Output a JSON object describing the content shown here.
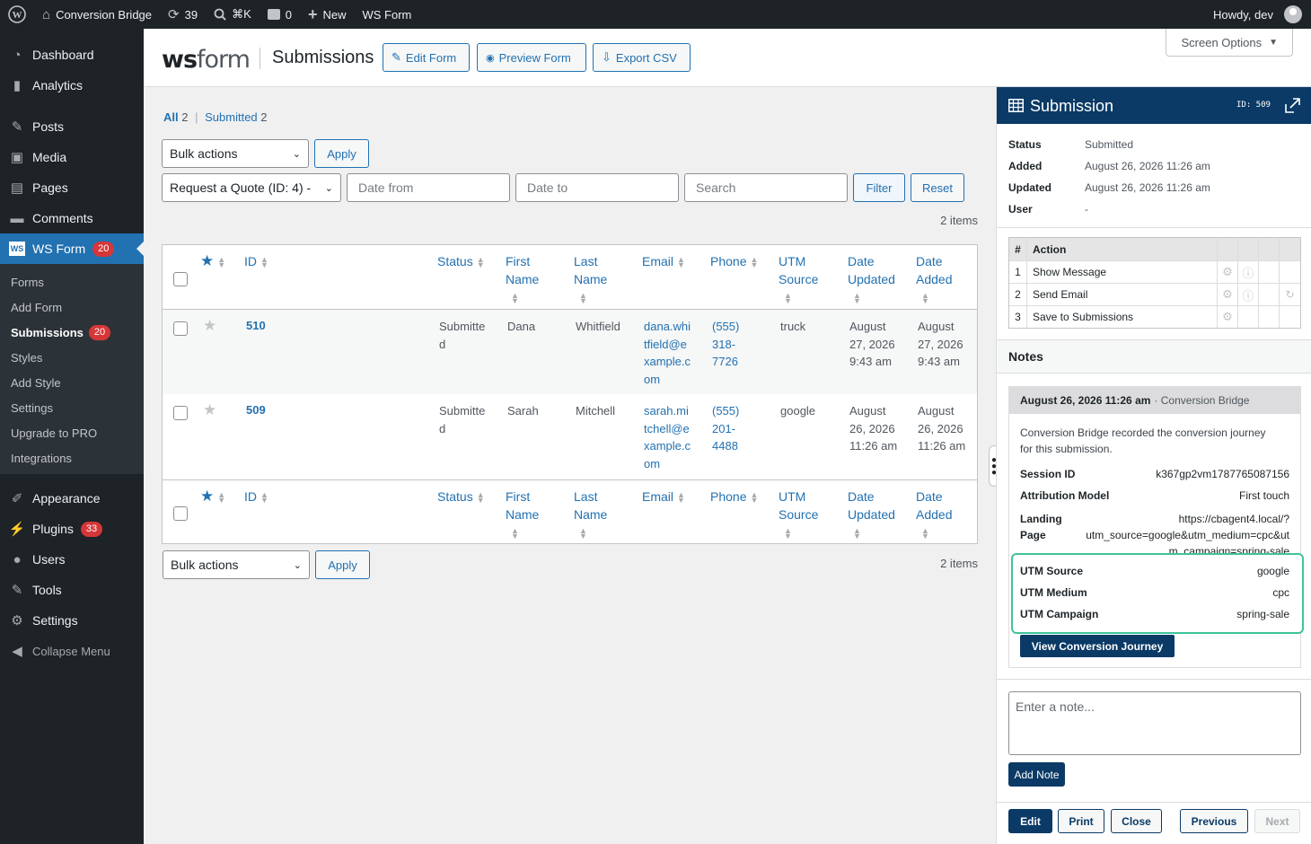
{
  "admin_bar": {
    "site_name": "Conversion Bridge",
    "updates_count": "39",
    "shortcut": "⌘K",
    "comments_count": "0",
    "new_label": "New",
    "ws_form_label": "WS Form",
    "greeting": "Howdy, dev"
  },
  "sidebar": {
    "items": [
      {
        "label": "Dashboard",
        "icon": "dashboard-icon"
      },
      {
        "label": "Analytics",
        "icon": "analytics-icon"
      },
      {
        "label": "Posts",
        "icon": "pin-icon"
      },
      {
        "label": "Media",
        "icon": "media-icon"
      },
      {
        "label": "Pages",
        "icon": "pages-icon"
      },
      {
        "label": "Comments",
        "icon": "comments-icon"
      },
      {
        "label": "WS Form",
        "icon": "wsform-icon",
        "badge": "20"
      }
    ],
    "submenu": [
      "Forms",
      "Add Form",
      "Submissions",
      "Styles",
      "Add Style",
      "Settings",
      "Upgrade to PRO",
      "Integrations"
    ],
    "submenu_badge": "20",
    "items2": [
      {
        "label": "Appearance"
      },
      {
        "label": "Plugins",
        "badge": "33"
      },
      {
        "label": "Users"
      },
      {
        "label": "Tools"
      },
      {
        "label": "Settings"
      },
      {
        "label": "Collapse Menu"
      }
    ]
  },
  "header": {
    "logo_ws": "ws",
    "logo_form": "form",
    "title": "Submissions",
    "edit_form": "Edit Form",
    "preview_form": "Preview Form",
    "export_csv": "Export CSV",
    "screen_options": "Screen Options"
  },
  "filters": {
    "all_label": "All",
    "all_count": "2",
    "submitted_label": "Submitted",
    "submitted_count": "2",
    "bulk_actions": "Bulk actions",
    "apply": "Apply",
    "form_select": "Request a Quote (ID: 4) -",
    "date_from": "Date from",
    "date_to": "Date to",
    "search": "Search",
    "filter": "Filter",
    "reset": "Reset",
    "items_count": "2 items"
  },
  "table": {
    "columns": {
      "id": "ID",
      "status": "Status",
      "first_name_1": "First",
      "first_name_2": "Name",
      "last_name_1": "Last",
      "last_name_2": "Name",
      "email": "Email",
      "phone": "Phone",
      "utm_1": "UTM",
      "utm_2": "Source",
      "updated_1": "Date",
      "updated_2": "Updated",
      "added_1": "Date",
      "added_2": "Added"
    },
    "rows": [
      {
        "id": "510",
        "status": [
          "Submitte",
          "d"
        ],
        "first": "Dana",
        "last": "Whitfield",
        "email": [
          "dana.whi",
          "tfield@e",
          "xample.c",
          "om"
        ],
        "phone": [
          "(555)",
          "318-",
          "7726"
        ],
        "utm": "truck",
        "updated": [
          "August",
          "27, 2026",
          "9:43 am"
        ],
        "added": [
          "August",
          "27, 2026",
          "9:43 am"
        ]
      },
      {
        "id": "509",
        "status": [
          "Submitte",
          "d"
        ],
        "first": "Sarah",
        "last": "Mitchell",
        "email": [
          "sarah.mi",
          "tchell@e",
          "xample.c",
          "om"
        ],
        "phone": [
          "(555)",
          "201-",
          "4488"
        ],
        "utm": "google",
        "updated": [
          "August",
          "26, 2026",
          "11:26 am"
        ],
        "added": [
          "August",
          "26, 2026",
          "11:26 am"
        ]
      }
    ]
  },
  "panel": {
    "title": "Submission",
    "id_label": "ID: 509",
    "status_k": "Status",
    "status_v": "Submitted",
    "added_k": "Added",
    "added_v": "August 26, 2026 11:26 am",
    "updated_k": "Updated",
    "updated_v": "August 26, 2026 11:26 am",
    "user_k": "User",
    "user_v": "-",
    "actions_header": {
      "num": "#",
      "action": "Action"
    },
    "actions": [
      {
        "num": "1",
        "action": "Show Message"
      },
      {
        "num": "2",
        "action": "Send Email"
      },
      {
        "num": "3",
        "action": "Save to Submissions"
      }
    ],
    "notes_title": "Notes",
    "note": {
      "date": "August 26, 2026 11:26 am",
      "author": "· Conversion Bridge",
      "text1": "Conversion Bridge recorded the conversion journey",
      "text2": "for this submission.",
      "session_k": "Session ID",
      "session_v": "k367gp2vm1787765087156",
      "model_k": "Attribution Model",
      "model_v": "First touch",
      "landing_k1": "Landing",
      "landing_k2": "Page",
      "landing_v1": "https://cbagent4.local/?",
      "landing_v2": "utm_source=google&utm_medium=cpc&ut",
      "landing_v3": "m_campaign=spring-sale",
      "utm_source_k": "UTM Source",
      "utm_source_v": "google",
      "utm_medium_k": "UTM Medium",
      "utm_medium_v": "cpc",
      "utm_campaign_k": "UTM Campaign",
      "utm_campaign_v": "spring-sale",
      "journey_button": "View Conversion Journey"
    },
    "note_placeholder": "Enter a note...",
    "add_note": "Add Note",
    "edit": "Edit",
    "print": "Print",
    "close": "Close",
    "previous": "Previous",
    "next": "Next"
  },
  "colors": {
    "admin_bg": "#1d2327",
    "accent": "#2271b1",
    "panel_header": "#0b3a66",
    "badge": "#d63638",
    "highlight": "#3fc49a"
  }
}
